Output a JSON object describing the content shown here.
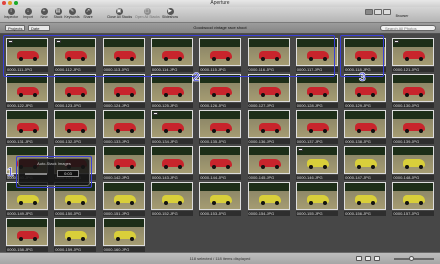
{
  "window": {
    "title": "Aperture"
  },
  "toolbar": {
    "tools": [
      {
        "label": "Inspector",
        "icon": "inspector-icon"
      },
      {
        "label": "Import",
        "icon": "import-icon"
      },
      {
        "label": "New",
        "icon": "new-icon"
      },
      {
        "label": "Stack",
        "icon": "stack-icon"
      },
      {
        "label": "Keywords",
        "icon": "keywords-icon"
      },
      {
        "label": "Share",
        "icon": "share-icon"
      },
      {
        "label": "Close All Stacks",
        "icon": "close-stacks-icon"
      },
      {
        "label": "Open All Stacks",
        "icon": "open-stacks-icon"
      },
      {
        "label": "Slideshow",
        "icon": "slideshow-icon"
      }
    ],
    "browser_label": "Browser"
  },
  "subbar": {
    "filter_value": "Projects",
    "view_value": "Date",
    "project_name": "Goodwood vintage race shoot",
    "search_placeholder": "Search All Photos"
  },
  "photos": [
    {
      "name": "0000-111.JPG",
      "car": "red",
      "badge": true
    },
    {
      "name": "0000-112.JPG",
      "car": "red",
      "badge": true
    },
    {
      "name": "0000-113.JPG",
      "car": "red",
      "badge": false
    },
    {
      "name": "0000-114.JPG",
      "car": "red",
      "badge": false
    },
    {
      "name": "0000-115.JPG",
      "car": "red",
      "badge": false
    },
    {
      "name": "0000-116.JPG",
      "car": "red",
      "badge": false
    },
    {
      "name": "0000-117.JPG",
      "car": "red",
      "badge": false
    },
    {
      "name": "0000-118.JPG",
      "car": "red",
      "badge": false
    },
    {
      "name": "0000-121.JPG",
      "car": "red",
      "badge": true
    },
    {
      "name": "0000-122.JPG",
      "car": "red",
      "badge": false
    },
    {
      "name": "0000-123.JPG",
      "car": "red",
      "badge": false
    },
    {
      "name": "0000-124.JPG",
      "car": "red",
      "badge": false
    },
    {
      "name": "0000-125.JPG",
      "car": "red",
      "badge": false
    },
    {
      "name": "0000-126.JPG",
      "car": "red",
      "badge": false
    },
    {
      "name": "0000-127.JPG",
      "car": "red",
      "badge": false
    },
    {
      "name": "0000-128.JPG",
      "car": "red",
      "badge": false
    },
    {
      "name": "0000-129.JPG",
      "car": "red",
      "badge": false
    },
    {
      "name": "0000-130.JPG",
      "car": "red",
      "badge": false
    },
    {
      "name": "0000-131.JPG",
      "car": "red",
      "badge": false
    },
    {
      "name": "0000-132.JPG",
      "car": "red",
      "badge": false
    },
    {
      "name": "0000-133.JPG",
      "car": "red",
      "badge": false
    },
    {
      "name": "0000-134.JPG",
      "car": "red",
      "badge": true
    },
    {
      "name": "0000-135.JPG",
      "car": "red",
      "badge": false
    },
    {
      "name": "0000-136.JPG",
      "car": "red",
      "badge": false
    },
    {
      "name": "0000-137.JPG",
      "car": "red",
      "badge": false
    },
    {
      "name": "0000-138.JPG",
      "car": "red",
      "badge": false
    },
    {
      "name": "0000-139.JPG",
      "car": "red",
      "badge": false
    },
    {
      "name": "0000-140.JPG",
      "car": "red",
      "badge": false
    },
    {
      "name": "0000-141.JPG",
      "car": "red",
      "badge": false
    },
    {
      "name": "0000-142.JPG",
      "car": "red",
      "badge": false
    },
    {
      "name": "0000-143.JPG",
      "car": "red",
      "badge": false
    },
    {
      "name": "0000-144.JPG",
      "car": "red",
      "badge": false
    },
    {
      "name": "0000-145.JPG",
      "car": "red",
      "badge": false
    },
    {
      "name": "0000-146.JPG",
      "car": "yellow",
      "badge": true
    },
    {
      "name": "0000-147.JPG",
      "car": "yellow",
      "badge": false
    },
    {
      "name": "0000-148.JPG",
      "car": "yellow",
      "badge": false
    },
    {
      "name": "0000-149.JPG",
      "car": "yellow",
      "badge": false
    },
    {
      "name": "0000-150.JPG",
      "car": "yellow",
      "badge": false
    },
    {
      "name": "0000-151.JPG",
      "car": "yellow",
      "badge": false
    },
    {
      "name": "0000-152.JPG",
      "car": "yellow",
      "badge": false
    },
    {
      "name": "0000-153.JPG",
      "car": "yellow",
      "badge": false
    },
    {
      "name": "0000-154.JPG",
      "car": "yellow",
      "badge": false
    },
    {
      "name": "0000-155.JPG",
      "car": "yellow",
      "badge": false
    },
    {
      "name": "0000-156.JPG",
      "car": "yellow",
      "badge": false
    },
    {
      "name": "0000-157.JPG",
      "car": "yellow",
      "badge": false
    },
    {
      "name": "0000-158.JPG",
      "car": "red",
      "badge": false
    },
    {
      "name": "0000-159.JPG",
      "car": "yellow",
      "badge": false
    },
    {
      "name": "0000-160.JPG",
      "car": "yellow",
      "badge": false
    }
  ],
  "hud": {
    "title": "Auto-Stack Images",
    "value": "0:03"
  },
  "callouts": [
    "1",
    "2",
    "3"
  ],
  "status": {
    "text": "118 selected / 118 items displayed"
  },
  "colors": {
    "callout": "#3a3fd6",
    "background": "#474747"
  }
}
